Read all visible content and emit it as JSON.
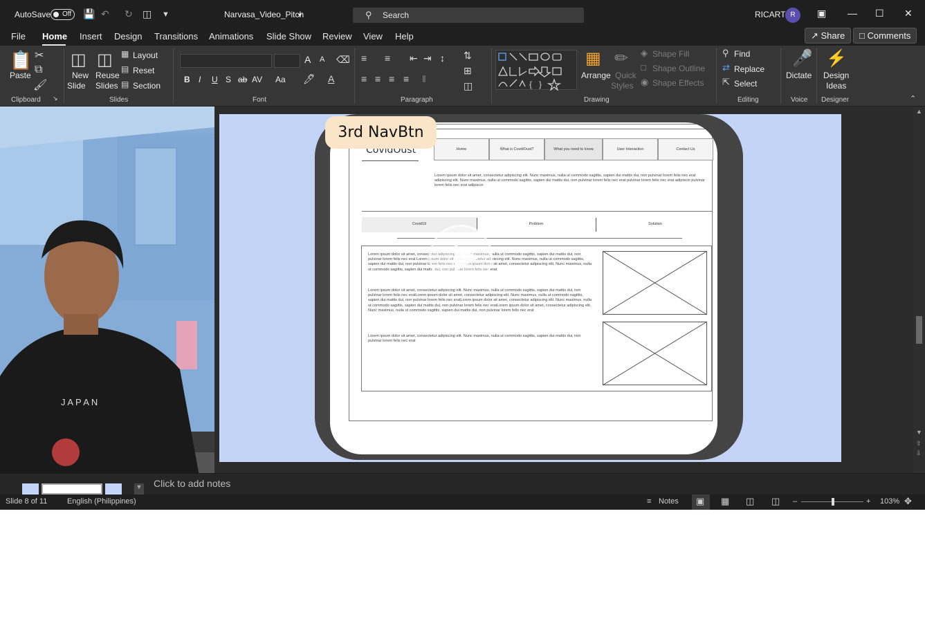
{
  "titlebar": {
    "autosave_label": "AutoSave",
    "autosave_state": "Off",
    "doc_title": "Narvasa_Video_Pitch",
    "search_placeholder": "Search",
    "user_name": "RICART",
    "user_initial": "R"
  },
  "tabs": [
    "File",
    "Home",
    "Insert",
    "Design",
    "Transitions",
    "Animations",
    "Slide Show",
    "Review",
    "View",
    "Help"
  ],
  "active_tab": "Home",
  "share_label": "Share",
  "comments_label": "Comments",
  "ribbon": {
    "clipboard": {
      "paste": "Paste",
      "label": "Clipboard"
    },
    "slides": {
      "new_slide_1": "New",
      "new_slide_2": "Slide",
      "reuse_1": "Reuse",
      "reuse_2": "Slides",
      "layout": "Layout",
      "reset": "Reset",
      "section": "Section",
      "label": "Slides"
    },
    "font": {
      "label": "Font",
      "bold": "B",
      "italic": "I",
      "underline": "U",
      "shadow": "S",
      "strike": "ab",
      "spacing": "AV",
      "case": "Aa",
      "grow": "A",
      "shrink": "A"
    },
    "paragraph": {
      "label": "Paragraph"
    },
    "drawing": {
      "arrange": "Arrange",
      "quick_styles_1": "Quick",
      "quick_styles_2": "Styles",
      "shape_fill": "Shape Fill",
      "shape_outline": "Shape Outline",
      "shape_effects": "Shape Effects",
      "label": "Drawing"
    },
    "editing": {
      "find": "Find",
      "replace": "Replace",
      "select": "Select",
      "label": "Editing"
    },
    "voice": {
      "dictate": "Dictate",
      "label": "Voice"
    },
    "designer": {
      "ideas_1": "Design",
      "ideas_2": "Ideas",
      "label": "Designer"
    }
  },
  "slide": {
    "badge": "3rd NavBtn",
    "logo": "CovidOust",
    "nav": [
      "Home",
      "What is CovidOust?",
      "What you need to know",
      "User Interaction",
      "Contact Us"
    ],
    "intro": "Lorem ipsum dolor sit amet, consectetur adipiscing elit. Nunc maximus, nulla ut commodo sagittis, sapien dui mattis dui, non pulvinar lorem felis nec erat adipiscing elit. Nunc maximus, nulla ut commodo sagittis, sapien dui mattis dui, non pulvinar lorem felis nec erat pulvinar lorem felis nec erat adipiscin pulvinar lorem felis nec erat adipiscin",
    "tabs": [
      "Covid19",
      "Problem",
      "Solution"
    ],
    "para1": "Lorem ipsum dolor sit amet, consectetur adipiscing elit. Nunc maximus, nulla ut commodo sagittis, sapien dui mattis dui, non pulvinar lorem felis nec erat Lorem ipsum dolor sit amet, consectetur adipiscing elit. Nunc maximus, nulla ut commodo sagittis, sapien dui mattis dui, non pulvinar lorem felis nec eratLorem ipsum dolor sit amet, consectetur adipiscing elit. Nunc maximus, nulla ut commodo sagittis, sapien dui mattis dui, non pulvinar lorem felis nec erat",
    "para2": "Lorem ipsum dolor sit amet, consectetur adipiscing elit. Nunc maximus, nulla ut commodo sagittis, sapien dui mattis dui, non pulvinar lorem felis nec eratLorem ipsum dolor sit amet, consectetur adipiscing elit. Nunc maximus, nulla ut commodo sagittis, sapien dui mattis dui, non pulvinar lorem felis nec eratLorem ipsum dolor sit amet, consectetur adipiscing elit. Nunc maximus, nulla ut commodo sagittis, sapien dui mattis dui, non pulvinar lorem felis nec eratLorem ipsum dolor sit amet, consectetur adipiscing elit. Nunc maximus, nulla ut commodo sagittis, sapien dui mattis dui, non pulvinar lorem felis nec erat",
    "para3": "Lorem ipsum dolor sit amet, consectetur adipiscing elit. Nunc maximus, nulla ut commodo sagittis, sapien dui mattis dui, non pulvinar lorem felis nec erat"
  },
  "webcam": {
    "shirt_text": "J A P A N"
  },
  "notes_placeholder": "Click to add notes",
  "status": {
    "slide_counter": "Slide 8 of 11",
    "language": "English (Philippines)",
    "notes_btn": "Notes",
    "zoom": "103%"
  },
  "colors": {
    "slide_bg": "#c4d4f7",
    "badge_bg": "#fbe5c8",
    "ribbon_bg": "#363636",
    "titlebar_bg": "#1f1f1f"
  }
}
